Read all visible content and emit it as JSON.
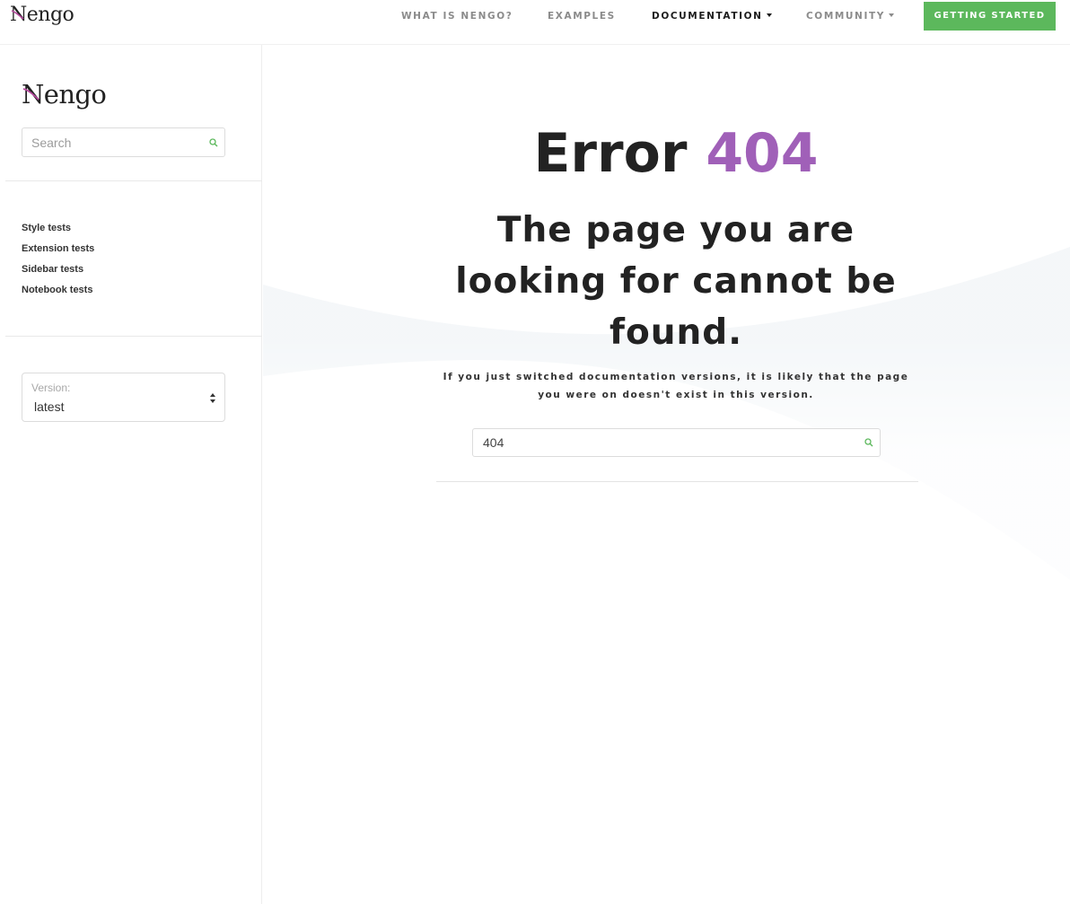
{
  "navbar": {
    "brand": "Nengo",
    "links": [
      {
        "label": "WHAT IS NENGO?"
      },
      {
        "label": "EXAMPLES"
      },
      {
        "label": "DOCUMENTATION",
        "active": true,
        "dropdown": true
      },
      {
        "label": "COMMUNITY",
        "dropdown": true
      }
    ],
    "cta_label": "GETTING STARTED"
  },
  "sidebar": {
    "logo": "Nengo",
    "search": {
      "placeholder": "Search",
      "icon": "search-icon"
    },
    "menu": [
      "Style tests",
      "Extension tests",
      "Sidebar tests",
      "Notebook tests"
    ],
    "version": {
      "label": "Version:",
      "value": "latest"
    }
  },
  "main": {
    "error_word": "Error",
    "error_code": "404",
    "heading": "The page you are looking for cannot be found.",
    "note": "If you just switched documentation versions, it is likely that the page you were on doesn't exist in this version.",
    "search": {
      "value": "404",
      "icon": "search-icon"
    }
  },
  "colors": {
    "accent_purple": "#a060b8",
    "cta_green": "#5cb85c",
    "search_icon_green": "#5cb85c",
    "logo_swoosh": "#b6489e",
    "background_wave": "#e8eef2"
  }
}
